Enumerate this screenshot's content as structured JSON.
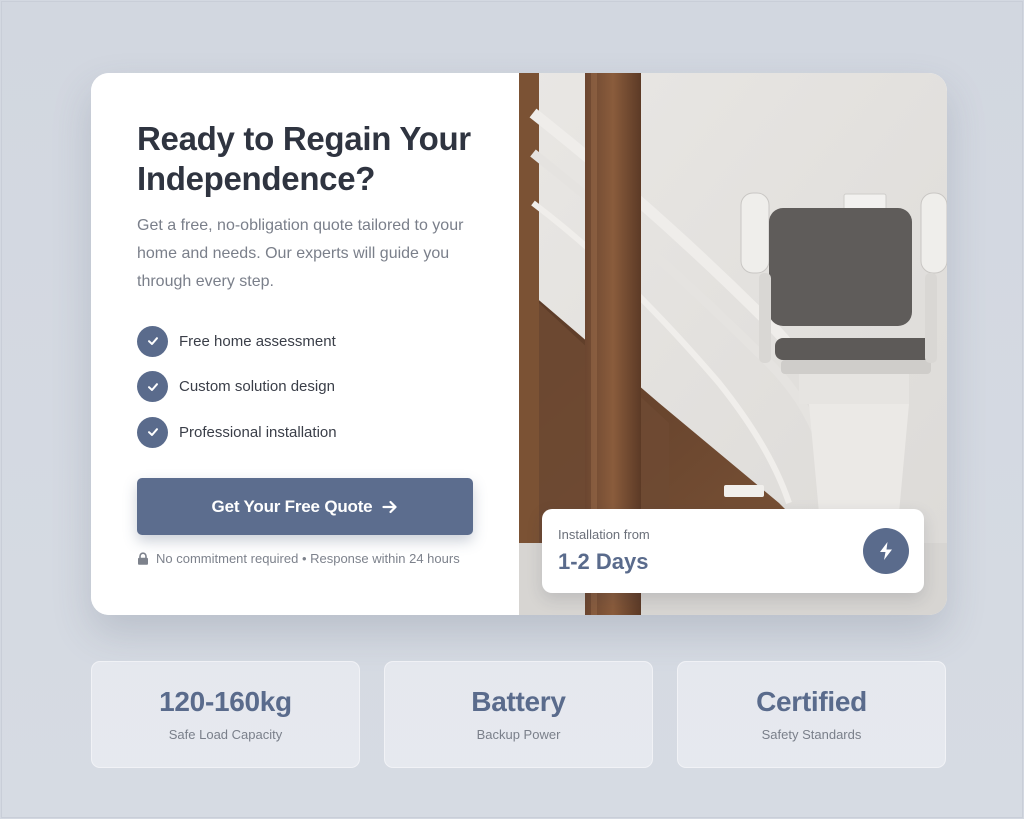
{
  "hero": {
    "title": "Ready to Regain Your Independence?",
    "subtitle": "Get a free, no-obligation quote tailored to your home and needs. Our experts will guide you through every step.",
    "features": [
      {
        "label": "Free home assessment",
        "icon": "check-icon"
      },
      {
        "label": "Custom solution design",
        "icon": "check-icon"
      },
      {
        "label": "Professional installation",
        "icon": "check-icon"
      }
    ],
    "cta_label": "Get Your Free Quote",
    "cta_icon": "arrow-right-icon",
    "note": "No commitment required • Response within 24 hours",
    "note_icon": "lock-icon"
  },
  "installation": {
    "label": "Installation from",
    "value": "1-2 Days",
    "icon": "lightning-icon"
  },
  "stats": [
    {
      "value": "120-160kg",
      "label": "Safe Load Capacity"
    },
    {
      "value": "Battery",
      "label": "Backup Power"
    },
    {
      "value": "Certified",
      "label": "Safety Standards"
    }
  ],
  "colors": {
    "accent": "#5a6b8c",
    "title_text": "#2f3440",
    "body_text": "#7a7f8a",
    "background": "#d3d8e1"
  }
}
